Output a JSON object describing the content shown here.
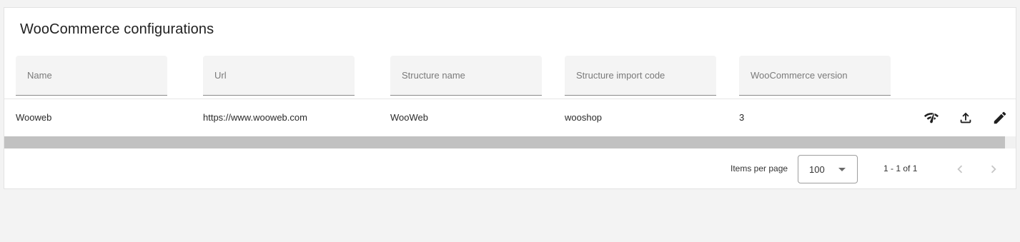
{
  "page": {
    "title": "WooCommerce configurations"
  },
  "filters": {
    "name": {
      "placeholder": "Name",
      "value": ""
    },
    "url": {
      "placeholder": "Url",
      "value": ""
    },
    "structure_name": {
      "placeholder": "Structure name",
      "value": ""
    },
    "structure_import_code": {
      "placeholder": "Structure import code",
      "value": ""
    },
    "woocommerce_version": {
      "placeholder": "WooCommerce version",
      "value": ""
    }
  },
  "rows": [
    {
      "name": "Wooweb",
      "url": "https://www.wooweb.com",
      "structure_name": "WooWeb",
      "structure_import_code": "wooshop",
      "woocommerce_version": "3",
      "actions": [
        "network-check-icon",
        "upload-icon",
        "edit-pencil-icon"
      ]
    }
  ],
  "paginator": {
    "items_per_page_label": "Items per page",
    "items_per_page_value": "100",
    "range_label": "1 - 1 of 1",
    "prev_icon": "chevron-left-icon",
    "next_icon": "chevron-right-icon"
  }
}
